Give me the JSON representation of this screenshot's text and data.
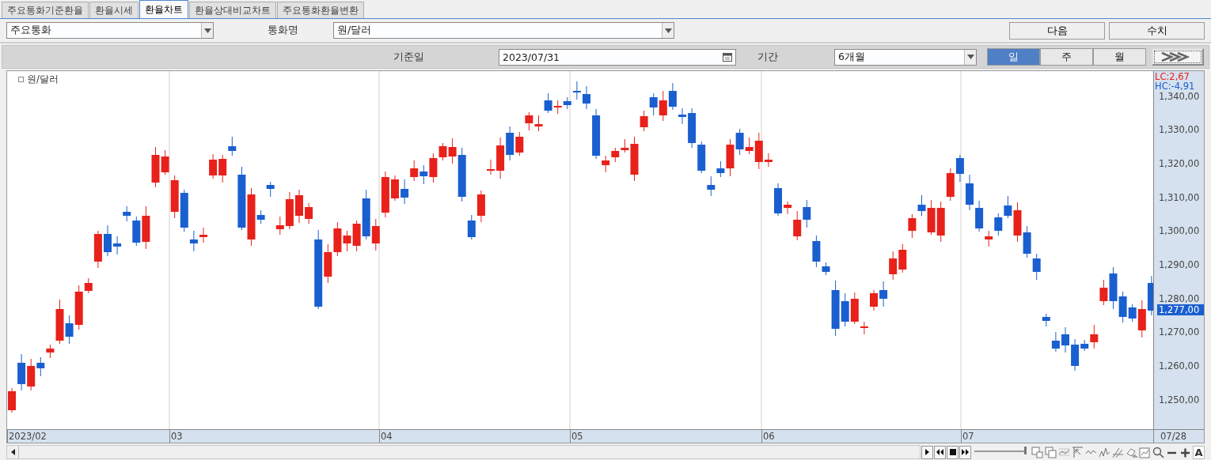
{
  "tabs": [
    {
      "label": "주요통화기준환율",
      "selected": false
    },
    {
      "label": "환율시세",
      "selected": false
    },
    {
      "label": "환율차트",
      "selected": true
    },
    {
      "label": "환율상대비교차트",
      "selected": false
    },
    {
      "label": "주요통화환율변환",
      "selected": false
    }
  ],
  "filter_row": {
    "group_select": {
      "value": "주요통화"
    },
    "currency_label": "통화명",
    "currency_select": {
      "value": "원/달러"
    },
    "buttons": [
      "다음",
      "수치"
    ]
  },
  "query_row": {
    "date_label": "기준일",
    "date_field": {
      "value": "2023/07/31"
    },
    "period_label": "기간",
    "period_select": {
      "value": "6개월"
    },
    "intervals": [
      {
        "label": "일",
        "selected": true
      },
      {
        "label": "주",
        "selected": false
      },
      {
        "label": "월",
        "selected": false
      }
    ]
  },
  "chart": {
    "legend": "원/달러",
    "lc": "LC:2,67",
    "hc": "HC:-4,91",
    "y_ticks": [
      "1,340,00",
      "1,330,00",
      "1,320,00",
      "1,310,00",
      "1,300,00",
      "1,290,00",
      "1,280,00",
      "1,270,00",
      "1,260,00",
      "1,250,00"
    ],
    "current_price": "1,277,00",
    "x_labels": [
      "2023/02",
      "03",
      "04",
      "05",
      "06",
      "07"
    ],
    "last_date": "07/28"
  },
  "bottom_bar": {
    "zoom_slider": {
      "level": 1
    },
    "font_button": "A"
  }
}
